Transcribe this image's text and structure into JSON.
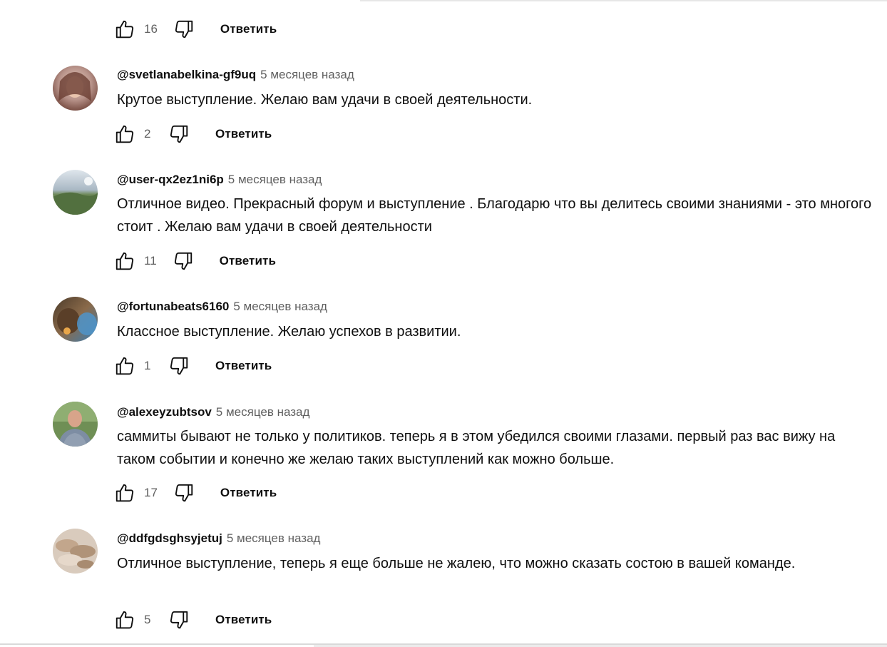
{
  "reply_label": "Ответить",
  "top_actions": {
    "likes": "16"
  },
  "comments": [
    {
      "author": "@svetlanabelkina-gf9uq",
      "time": "5 месяцев назад",
      "text": "Крутое выступление. Желаю вам удачи в своей деятельности.",
      "likes": "2",
      "avatar_colors": [
        "#b8938a",
        "#7a4f45"
      ]
    },
    {
      "author": "@user-qx2ez1ni6p",
      "time": "5 месяцев назад",
      "text": "Отличное видео. Прекрасный форум и выступление . Благодарю что вы делитесь своими знаниями - это многого стоит . Желаю вам удачи в своей деятельности",
      "likes": "11",
      "avatar_colors": [
        "#c9d3dc",
        "#4d6b3c"
      ]
    },
    {
      "author": "@fortunabeats6160",
      "time": "5 месяцев назад",
      "text": "Классное выступление. Желаю успехов в развитии.",
      "likes": "1",
      "avatar_colors": [
        "#3c7fb5",
        "#6b4a2e"
      ]
    },
    {
      "author": "@alexeyzubtsov",
      "time": "5 месяцев назад",
      "text": "саммиты бывают не только у политиков. теперь я в этом убедился своими глазами. первый раз вас вижу на таком событии и конечно же желаю таких выступлений как можно больше.",
      "likes": "17",
      "avatar_colors": [
        "#6f8f55",
        "#7d8da3"
      ]
    },
    {
      "author": "@ddfgdsghsyjetuj",
      "time": "5 месяцев назад",
      "text": "Отличное выступление, теперь я еще больше не жалею, что можно сказать состою в вашей команде.",
      "likes": "5",
      "avatar_colors": [
        "#d9cbbd",
        "#b09378"
      ]
    }
  ]
}
